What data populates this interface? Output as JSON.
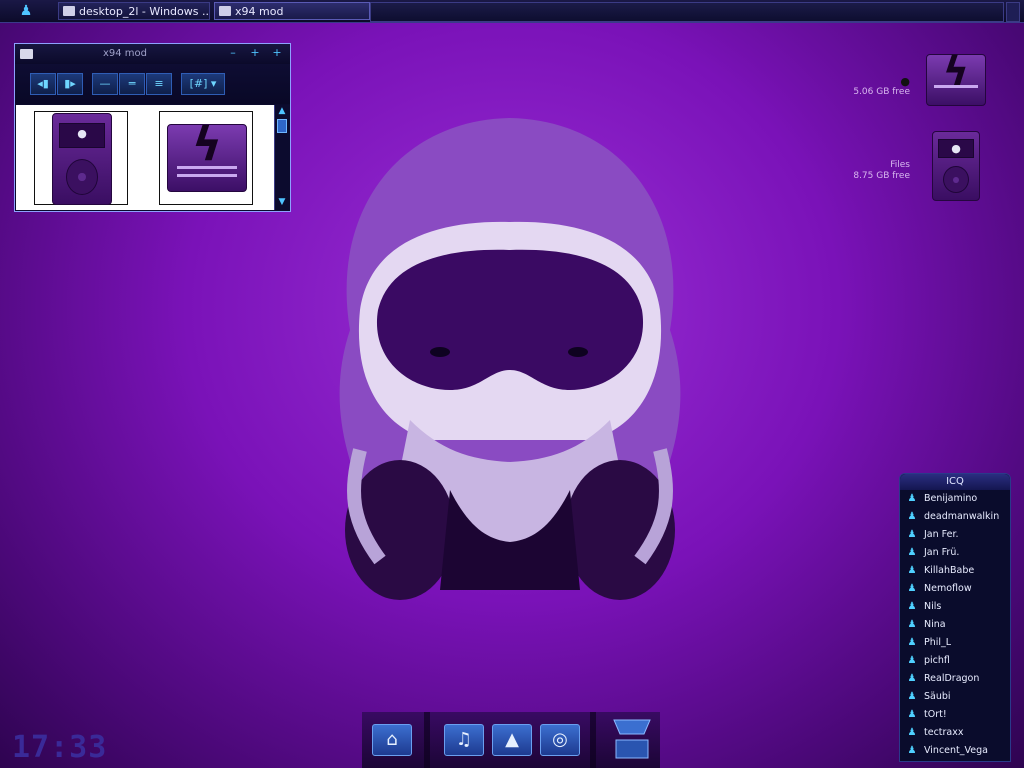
{
  "taskbar": {
    "tasks": [
      {
        "label": "desktop_2l - Windows ...",
        "active": false
      },
      {
        "label": "x94 mod",
        "active": true
      }
    ]
  },
  "explorer": {
    "title": "x94 mod",
    "controls": [
      "–",
      "+",
      "+"
    ],
    "toolbar": [
      "◂▮",
      "▮▸",
      "—",
      "═",
      "≡",
      "[#] ▾"
    ]
  },
  "desktop_drives": [
    {
      "name": "",
      "free": "5.06 GB free",
      "icon": "drive-icon"
    },
    {
      "name": "Files",
      "free": "8.75 GB free",
      "icon": "ipod-icon"
    }
  ],
  "icq": {
    "title": "ICQ",
    "contacts": [
      "Benijamino",
      "deadmanwalkin",
      "Jan Fer.",
      "Jan Frü.",
      "KillahBabe",
      "Nemoflow",
      "Nils",
      "Nina",
      "Phil_L",
      "pichfl",
      "RealDragon",
      "Säubi",
      "tOrt!",
      "tectraxx",
      "Vincent_Vega"
    ]
  },
  "clock": "17:33",
  "dock": {
    "items": [
      "home-icon",
      "music-folder-icon",
      "pictures-folder-icon",
      "quicktime-icon"
    ]
  },
  "colors": {
    "accent": "#4fc4ff",
    "background": "#7a12b8"
  }
}
